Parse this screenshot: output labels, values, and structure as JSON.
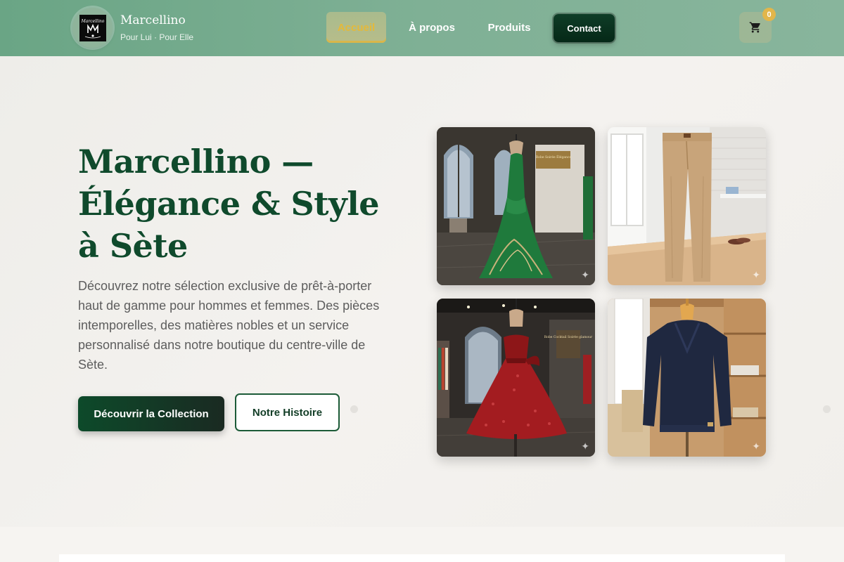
{
  "header": {
    "logo_text": "Marcellino",
    "brand_name": "Marcellino",
    "brand_tagline": "Pour Lui · Pour Elle",
    "nav": {
      "accueil": "Accueil",
      "apropos": "À propos",
      "produits": "Produits",
      "contact": "Contact"
    },
    "cart_icon": "cart-icon",
    "cart_count": "0"
  },
  "hero": {
    "title": "Marcellino — Élégance & Style à Sète",
    "description": "Découvrez notre sélection exclusive de prêt-à-porter haut de gamme pour hommes et femmes. Des pièces intemporelles, des matières nobles et un service personnalisé dans notre boutique du centre-ville de Sète.",
    "cta_primary": "Découvrir la Collection",
    "cta_secondary": "Notre Histoire"
  },
  "products": [
    {
      "name": "green-evening-gown",
      "sign_text": "Robe Soirée Élégance"
    },
    {
      "name": "beige-chino-trousers",
      "sign_text": ""
    },
    {
      "name": "red-sequin-cocktail-dress",
      "sign_text": "Robe Cocktail Soirée glamour"
    },
    {
      "name": "navy-v-neck-sweater",
      "sign_text": ""
    }
  ],
  "colors": {
    "header_green": "#7fb095",
    "brand_green": "#0f4a2c",
    "accent_gold": "#e2b64a",
    "contact_green": "#0a3320"
  }
}
